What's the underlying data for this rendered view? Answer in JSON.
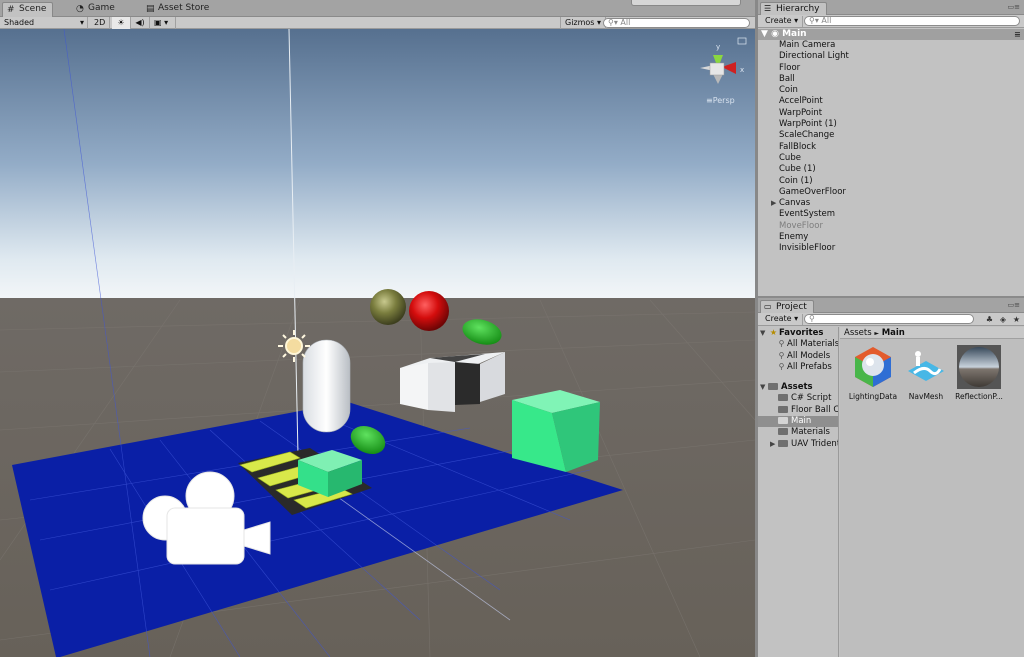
{
  "scene_tabs": [
    {
      "label": "Scene",
      "icon": "grid-icon"
    },
    {
      "label": "Game",
      "icon": "pacman-icon"
    },
    {
      "label": "Asset Store",
      "icon": "store-icon"
    }
  ],
  "scene_toolbar": {
    "shading": "Shaded",
    "mode_2d": "2D",
    "light_icon": "☀",
    "audio_icon": "◀)",
    "effects_icon": "▣",
    "gizmos": "Gizmos",
    "search_placeholder": "All"
  },
  "viewport": {
    "projection_label": "≡Persp"
  },
  "hierarchy": {
    "tab_label": "Hierarchy",
    "create_label": "Create",
    "search_placeholder": "All",
    "scene_name": "Main",
    "items": [
      {
        "label": "Main Camera",
        "enabled": true
      },
      {
        "label": "Directional Light",
        "enabled": true
      },
      {
        "label": "Floor",
        "enabled": true
      },
      {
        "label": "Ball",
        "enabled": true
      },
      {
        "label": "Coin",
        "enabled": true
      },
      {
        "label": "AccelPoint",
        "enabled": true
      },
      {
        "label": "WarpPoint",
        "enabled": true
      },
      {
        "label": "WarpPoint (1)",
        "enabled": true
      },
      {
        "label": "ScaleChange",
        "enabled": true
      },
      {
        "label": "FallBlock",
        "enabled": true
      },
      {
        "label": "Cube",
        "enabled": true
      },
      {
        "label": "Cube (1)",
        "enabled": true
      },
      {
        "label": "Coin (1)",
        "enabled": true
      },
      {
        "label": "GameOverFloor",
        "enabled": true
      },
      {
        "label": "Canvas",
        "enabled": true,
        "expandable": true
      },
      {
        "label": "EventSystem",
        "enabled": true
      },
      {
        "label": "MoveFloor",
        "enabled": false
      },
      {
        "label": "Enemy",
        "enabled": true
      },
      {
        "label": "InvisibleFloor",
        "enabled": true
      }
    ]
  },
  "project": {
    "tab_label": "Project",
    "create_label": "Create",
    "favorites_label": "Favorites",
    "favorites": [
      "All Materials",
      "All Models",
      "All Prefabs"
    ],
    "assets_label": "Assets",
    "folders": [
      {
        "label": "C# Script",
        "selected": false,
        "expandable": false
      },
      {
        "label": "Floor Ball C",
        "selected": false,
        "expandable": false
      },
      {
        "label": "Main",
        "selected": true,
        "expandable": false
      },
      {
        "label": "Materials",
        "selected": false,
        "expandable": false
      },
      {
        "label": "UAV Trident",
        "selected": false,
        "expandable": true
      }
    ],
    "breadcrumb": [
      "Assets",
      "Main"
    ],
    "breadcrumb_sep": "►",
    "assets": [
      {
        "label": "LightingData",
        "icon": "lighting-data-icon"
      },
      {
        "label": "NavMesh",
        "icon": "navmesh-icon"
      },
      {
        "label": "ReflectionP...",
        "icon": "reflection-probe-icon"
      }
    ]
  },
  "colors": {
    "floor_blue": "#0a1fa6",
    "ball_red": "#d40d0d",
    "ball_olive": "#7a7d3e",
    "coin_green": "#1db41d",
    "cube_mint": "#35e88a"
  }
}
